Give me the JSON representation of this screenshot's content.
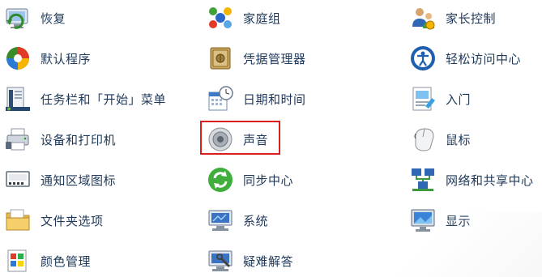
{
  "columns": [
    {
      "items": [
        {
          "label": "恢复",
          "icon": "system-restore-icon",
          "key": "recovery"
        },
        {
          "label": "默认程序",
          "icon": "default-programs-icon",
          "key": "default-programs"
        },
        {
          "label": "任务栏和「开始」菜单",
          "icon": "taskbar-icon",
          "key": "taskbar-start-menu"
        },
        {
          "label": "设备和打印机",
          "icon": "printer-icon",
          "key": "devices-printers"
        },
        {
          "label": "通知区域图标",
          "icon": "notification-area-icon",
          "key": "notification-icons"
        },
        {
          "label": "文件夹选项",
          "icon": "folder-icon",
          "key": "folder-options"
        },
        {
          "label": "颜色管理",
          "icon": "color-management-icon",
          "key": "color-management"
        }
      ]
    },
    {
      "items": [
        {
          "label": "家庭组",
          "icon": "homegroup-icon",
          "key": "homegroup"
        },
        {
          "label": "凭据管理器",
          "icon": "credential-safe-icon",
          "key": "credential-manager"
        },
        {
          "label": "日期和时间",
          "icon": "calendar-clock-icon",
          "key": "date-time"
        },
        {
          "label": "声音",
          "icon": "speaker-icon",
          "key": "sound",
          "highlighted": true
        },
        {
          "label": "同步中心",
          "icon": "sync-icon",
          "key": "sync-center"
        },
        {
          "label": "系统",
          "icon": "system-icon",
          "key": "system"
        },
        {
          "label": "疑难解答",
          "icon": "troubleshooting-icon",
          "key": "troubleshooting"
        }
      ]
    },
    {
      "items": [
        {
          "label": "家长控制",
          "icon": "parental-controls-icon",
          "key": "parental-controls"
        },
        {
          "label": "轻松访问中心",
          "icon": "ease-of-access-icon",
          "key": "ease-of-access"
        },
        {
          "label": "入门",
          "icon": "getting-started-icon",
          "key": "getting-started"
        },
        {
          "label": "鼠标",
          "icon": "mouse-icon",
          "key": "mouse"
        },
        {
          "label": "网络和共享中心",
          "icon": "network-icon",
          "key": "network-sharing"
        },
        {
          "label": "显示",
          "icon": "display-icon",
          "key": "display"
        }
      ]
    }
  ],
  "colors": {
    "label": "#1e395b",
    "highlight_border": "#d81e1e"
  }
}
